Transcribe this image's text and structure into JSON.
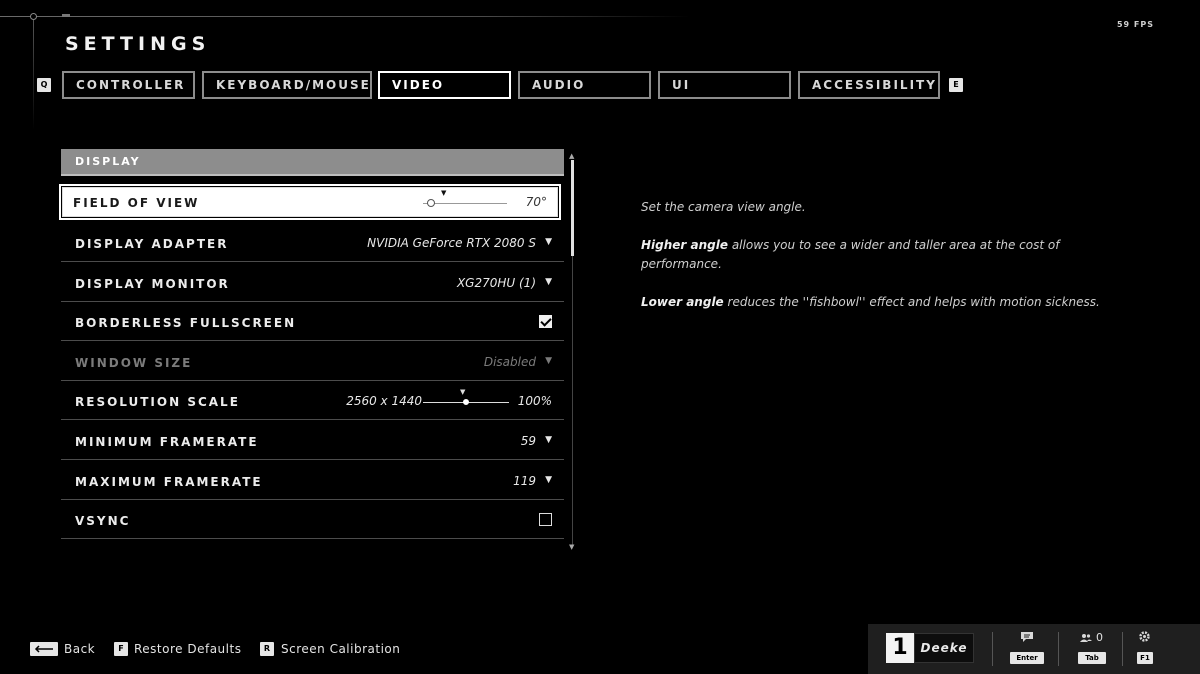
{
  "fps": "59 FPS",
  "title": "SETTINGS",
  "tabs": {
    "prev_key": "Q",
    "next_key": "E",
    "items": [
      {
        "label": "CONTROLLER",
        "active": false
      },
      {
        "label": "KEYBOARD/MOUSE",
        "active": false
      },
      {
        "label": "VIDEO",
        "active": true
      },
      {
        "label": "AUDIO",
        "active": false
      },
      {
        "label": "UI",
        "active": false
      },
      {
        "label": "ACCESSIBILITY",
        "active": false
      }
    ]
  },
  "section": {
    "header": "DISPLAY",
    "rows": [
      {
        "label": "FIELD OF VIEW",
        "value": "70°",
        "slider_value": 0.1
      },
      {
        "label": "DISPLAY ADAPTER",
        "value": "NVIDIA GeForce RTX 2080 S"
      },
      {
        "label": "DISPLAY MONITOR",
        "value": "XG270HU (1)"
      },
      {
        "label": "BORDERLESS FULLSCREEN",
        "checked": true
      },
      {
        "label": "WINDOW SIZE",
        "value": "Disabled",
        "disabled": true
      },
      {
        "label": "RESOLUTION SCALE",
        "resolution": "2560 x 1440",
        "value": "100%",
        "slider_value": 0.5
      },
      {
        "label": "MINIMUM FRAMERATE",
        "value": "59"
      },
      {
        "label": "MAXIMUM FRAMERATE",
        "value": "119"
      },
      {
        "label": "VSYNC",
        "checked": false
      }
    ]
  },
  "description": {
    "line1": "Set the camera view angle.",
    "higher_bold": "Higher angle",
    "higher_rest": " allows you to see a wider and taller area at the cost of performance.",
    "lower_bold": "Lower angle",
    "lower_rest": " reduces the ''fishbowl'' effect and helps with motion sickness."
  },
  "footer": {
    "back_label": "Back",
    "restore_key": "F",
    "restore_label": "Restore Defaults",
    "calibration_key": "R",
    "calibration_label": "Screen Calibration"
  },
  "dock": {
    "rank": "1",
    "gamertag": "Deeke",
    "chat_key": "Enter",
    "party_count": "0",
    "party_key": "Tab",
    "settings_key": "F1"
  }
}
